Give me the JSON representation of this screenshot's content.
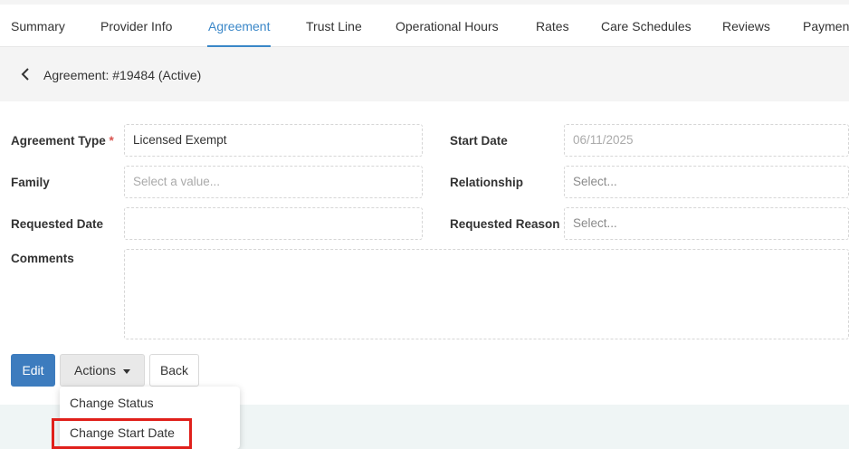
{
  "tabs": [
    {
      "label": "Summary"
    },
    {
      "label": "Provider Info"
    },
    {
      "label": "Agreement"
    },
    {
      "label": "Trust Line"
    },
    {
      "label": "Operational Hours"
    },
    {
      "label": "Rates"
    },
    {
      "label": "Care Schedules"
    },
    {
      "label": "Reviews"
    },
    {
      "label": "Payment"
    }
  ],
  "active_tab": "Agreement",
  "header": {
    "title": "Agreement: #19484 (Active)"
  },
  "form": {
    "agreement_type": {
      "label": "Agreement Type",
      "required_mark": "*",
      "value": "Licensed Exempt"
    },
    "start_date": {
      "label": "Start Date",
      "value": "06/11/2025"
    },
    "family": {
      "label": "Family",
      "placeholder": "Select a value..."
    },
    "relationship": {
      "label": "Relationship",
      "placeholder": "Select..."
    },
    "requested_date": {
      "label": "Requested Date",
      "value": ""
    },
    "requested_reason": {
      "label": "Requested Reason",
      "placeholder": "Select..."
    },
    "comments": {
      "label": "Comments",
      "value": ""
    }
  },
  "buttons": {
    "edit": "Edit",
    "actions": "Actions",
    "back": "Back"
  },
  "actions_menu": {
    "items": [
      {
        "label": "Change Status"
      },
      {
        "label": "Change Start Date"
      }
    ]
  },
  "colors": {
    "accent": "#3a87c8",
    "edit_button": "#3d7cbe",
    "required": "#d9534f",
    "highlight": "#e0201b"
  },
  "icons": {
    "back": "chevron-left-icon",
    "caret": "caret-down-icon"
  }
}
